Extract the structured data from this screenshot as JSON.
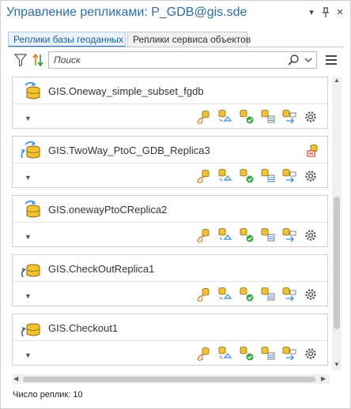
{
  "window": {
    "title": "Управление репликами: P_GDB@gis.sde",
    "menu_glyph": "▾",
    "pin_glyph": "⊥",
    "close_glyph": "✕"
  },
  "tabs": [
    {
      "label": "Реплики базы геоданных",
      "active": true
    },
    {
      "label": "Реплики сервиса объектов",
      "active": false
    }
  ],
  "toolbar": {
    "search_placeholder": "Поиск",
    "filter_icon": "filter-icon",
    "sort_icon": "sort-icon",
    "menu_icon": "hamburger-menu-icon"
  },
  "replicas": [
    {
      "name": "GIS.Oneway_simple_subset_fgdb",
      "icon": "oneway-replica-icon",
      "conflict": false
    },
    {
      "name": "GIS.TwoWay_PtoC_GDB_Replica3",
      "icon": "twoway-replica-icon",
      "conflict": true
    },
    {
      "name": "GIS.onewayPtoCReplica2",
      "icon": "oneway-replica-icon",
      "conflict": false
    },
    {
      "name": "GIS.CheckOutReplica1",
      "icon": "checkout-replica-icon",
      "conflict": false
    },
    {
      "name": "GIS.Checkout1",
      "icon": "checkout-replica-icon",
      "conflict": false
    }
  ],
  "actions": [
    "synchronize-icon",
    "export-changes-icon",
    "validate-icon",
    "export-schema-icon",
    "compare-schema-icon",
    "properties-gear-icon"
  ],
  "status": {
    "count_label": "Число реплик: 10"
  },
  "colors": {
    "accent": "#2a78c8",
    "title": "#2a6db0",
    "db_yellow": "#f2c230",
    "arrow_blue": "#3a8ee6",
    "check_green": "#3aa648",
    "conflict_red": "#d9402b"
  }
}
